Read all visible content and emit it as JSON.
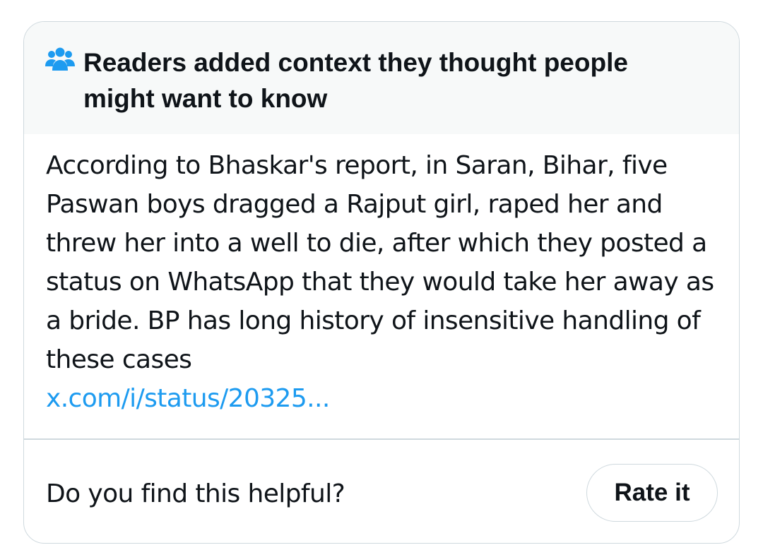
{
  "note": {
    "header": {
      "icon": "readers-group-icon",
      "title": "Readers added context they thought people might want to know"
    },
    "body": {
      "text": "According to Bhaskar's report, in Saran, Bihar, five Paswan boys dragged a Rajput girl, raped her and threw her into a well to die, after which they posted a status on WhatsApp that they would take her away as a bride. BP has long history of insensitive handling of these cases",
      "link_text": "x.com/i/status/20325..."
    },
    "footer": {
      "question": "Do you find this helpful?",
      "rate_button_label": "Rate it"
    }
  },
  "colors": {
    "accent": "#1d9bf0",
    "text": "#0f1419",
    "header_bg": "#f7f9f9",
    "border": "#cfd9de"
  }
}
